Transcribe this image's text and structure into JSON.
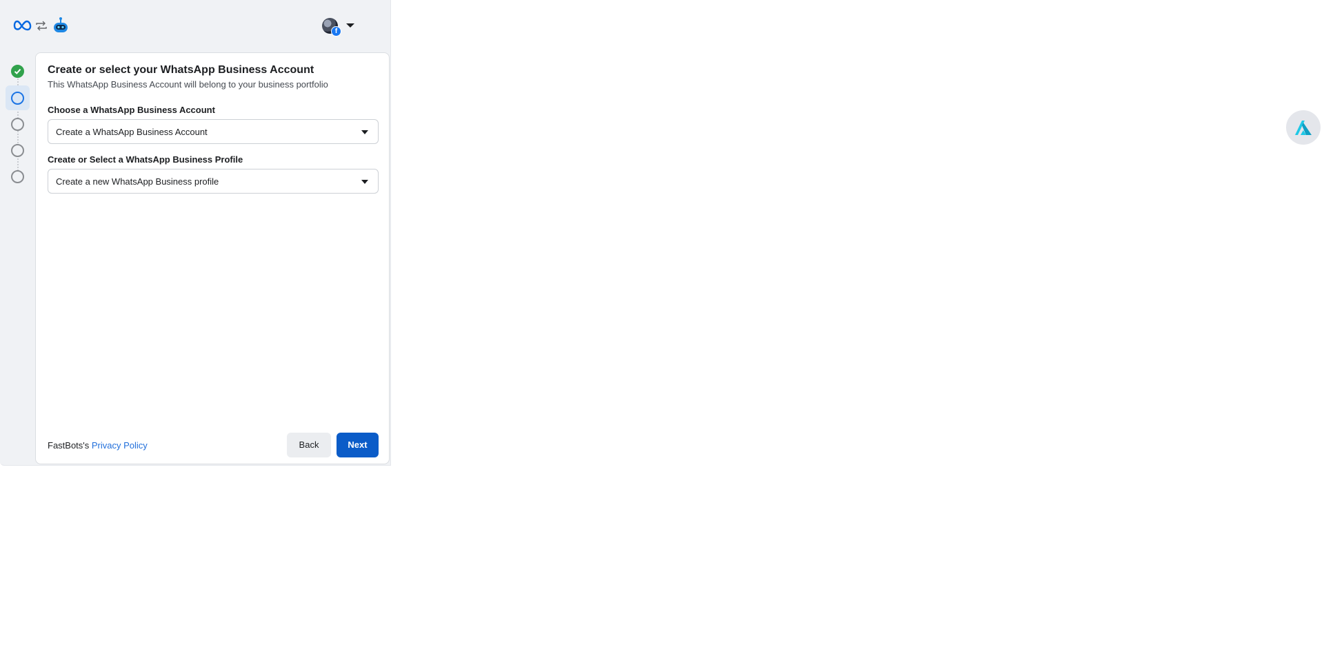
{
  "header": {
    "logo_icon": "meta-logo-icon",
    "swap_icon": "swap-arrows-icon",
    "app_icon": "robot-icon",
    "profile_badge": "f"
  },
  "stepper": {
    "steps": [
      {
        "state": "completed"
      },
      {
        "state": "current"
      },
      {
        "state": "pending"
      },
      {
        "state": "pending"
      },
      {
        "state": "pending"
      }
    ]
  },
  "form": {
    "title": "Create or select your WhatsApp Business Account",
    "subtitle": "This WhatsApp Business Account will belong to your business portfolio",
    "account_label": "Choose a WhatsApp Business Account",
    "account_value": "Create a WhatsApp Business Account",
    "profile_label": "Create or Select a WhatsApp Business Profile",
    "profile_value": "Create a new WhatsApp Business profile"
  },
  "footer": {
    "prefix": "FastBots's ",
    "privacy_link": "Privacy Policy",
    "back_label": "Back",
    "next_label": "Next"
  },
  "colors": {
    "primary": "#0b5cc8",
    "link": "#216fdb",
    "success": "#31a24c",
    "background": "#f0f2f5"
  }
}
